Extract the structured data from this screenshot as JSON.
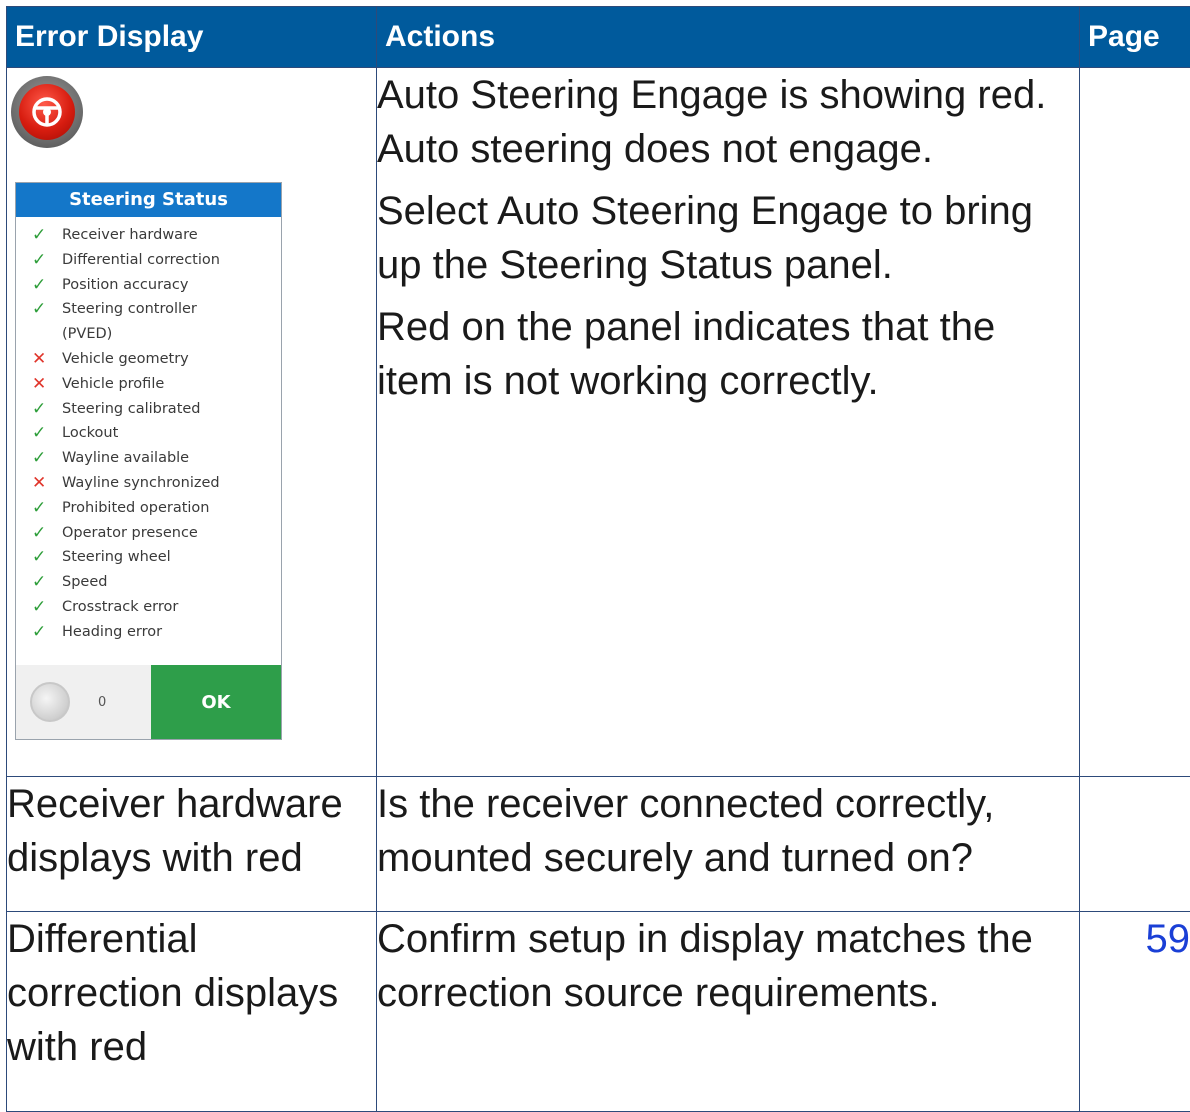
{
  "table": {
    "headers": {
      "error_display": "Error Display",
      "actions": "Actions",
      "page": "Page"
    },
    "rows": [
      {
        "error": "",
        "actions": [
          "Auto Steering Engage is showing red. Auto steering does not engage.",
          "Select Auto Steering Engage to bring up the Steering Status panel.",
          "Red on the panel indicates that the item is not working correctly."
        ],
        "page": ""
      },
      {
        "error": "Receiver hardware displays with red",
        "actions": [
          "Is the receiver connected correctly, mounted securely and turned on?"
        ],
        "page": ""
      },
      {
        "error": "Differential correction displays with red",
        "actions": [
          "Confirm setup in display matches the correction source requirements."
        ],
        "page": "59"
      }
    ]
  },
  "engage_icon": {
    "icon": "steering-wheel-icon",
    "color": "#d81d10"
  },
  "steering_panel": {
    "title": "Steering Status",
    "items": [
      {
        "label": "Receiver hardware",
        "status": "ok"
      },
      {
        "label": "Differential correction",
        "status": "ok"
      },
      {
        "label": "Position accuracy",
        "status": "ok"
      },
      {
        "label": "Steering controller",
        "status": "ok"
      },
      {
        "label": "(PVED)",
        "status": "none"
      },
      {
        "label": "Vehicle geometry",
        "status": "bad"
      },
      {
        "label": "Vehicle profile",
        "status": "bad"
      },
      {
        "label": "Steering calibrated",
        "status": "ok"
      },
      {
        "label": "Lockout",
        "status": "ok"
      },
      {
        "label": "Wayline available",
        "status": "ok"
      },
      {
        "label": "Wayline synchronized",
        "status": "bad"
      },
      {
        "label": "Prohibited operation",
        "status": "ok"
      },
      {
        "label": "Operator presence",
        "status": "ok"
      },
      {
        "label": "Steering wheel",
        "status": "ok"
      },
      {
        "label": "Speed",
        "status": "ok"
      },
      {
        "label": "Crosstrack error",
        "status": "ok"
      },
      {
        "label": "Heading error",
        "status": "ok"
      }
    ],
    "footer": {
      "count": "0",
      "ok_label": "OK"
    },
    "colors": {
      "ok": "#2e9e3a",
      "bad": "#e0352b",
      "title_bg": "#1477c9",
      "ok_button": "#2e9e4a"
    }
  },
  "colors": {
    "header_bg": "#005a9c",
    "link": "#1a3fd6"
  }
}
